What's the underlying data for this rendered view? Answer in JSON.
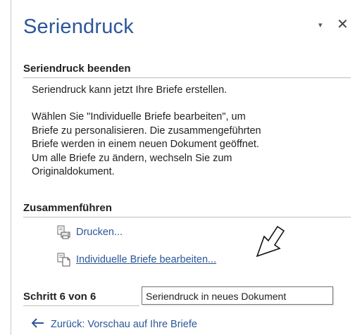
{
  "pane": {
    "title": "Seriendruck",
    "dropdown_glyph": "▾",
    "close_glyph": "✕"
  },
  "finish": {
    "heading": "Seriendruck beenden",
    "line1": "Seriendruck kann jetzt Ihre Briefe erstellen.",
    "para_lines": [
      "Wählen Sie \"Individuelle Briefe bearbeiten\", um",
      "Briefe zu personalisieren. Die zusammengeführten",
      "Briefe werden in einem neuen Dokument geöffnet.",
      "Um alle Briefe zu ändern, wechseln Sie zum",
      "Originaldokument."
    ]
  },
  "merge": {
    "heading": "Zusammenführen",
    "print_label": "Drucken...",
    "print_icon": "print-merge-icon",
    "edit_label": "Individuelle Briefe bearbeiten...",
    "edit_icon": "edit-document-icon"
  },
  "step": {
    "label": "Schritt 6 von 6"
  },
  "tooltip": {
    "text": "Seriendruck in neues Dokument"
  },
  "nav": {
    "back_label": "Zurück: Vorschau auf Ihre Briefe",
    "back_icon": "left-arrow-icon"
  },
  "colors": {
    "accent": "#2b579a",
    "text": "#222222",
    "divider": "#bdbdbd"
  }
}
